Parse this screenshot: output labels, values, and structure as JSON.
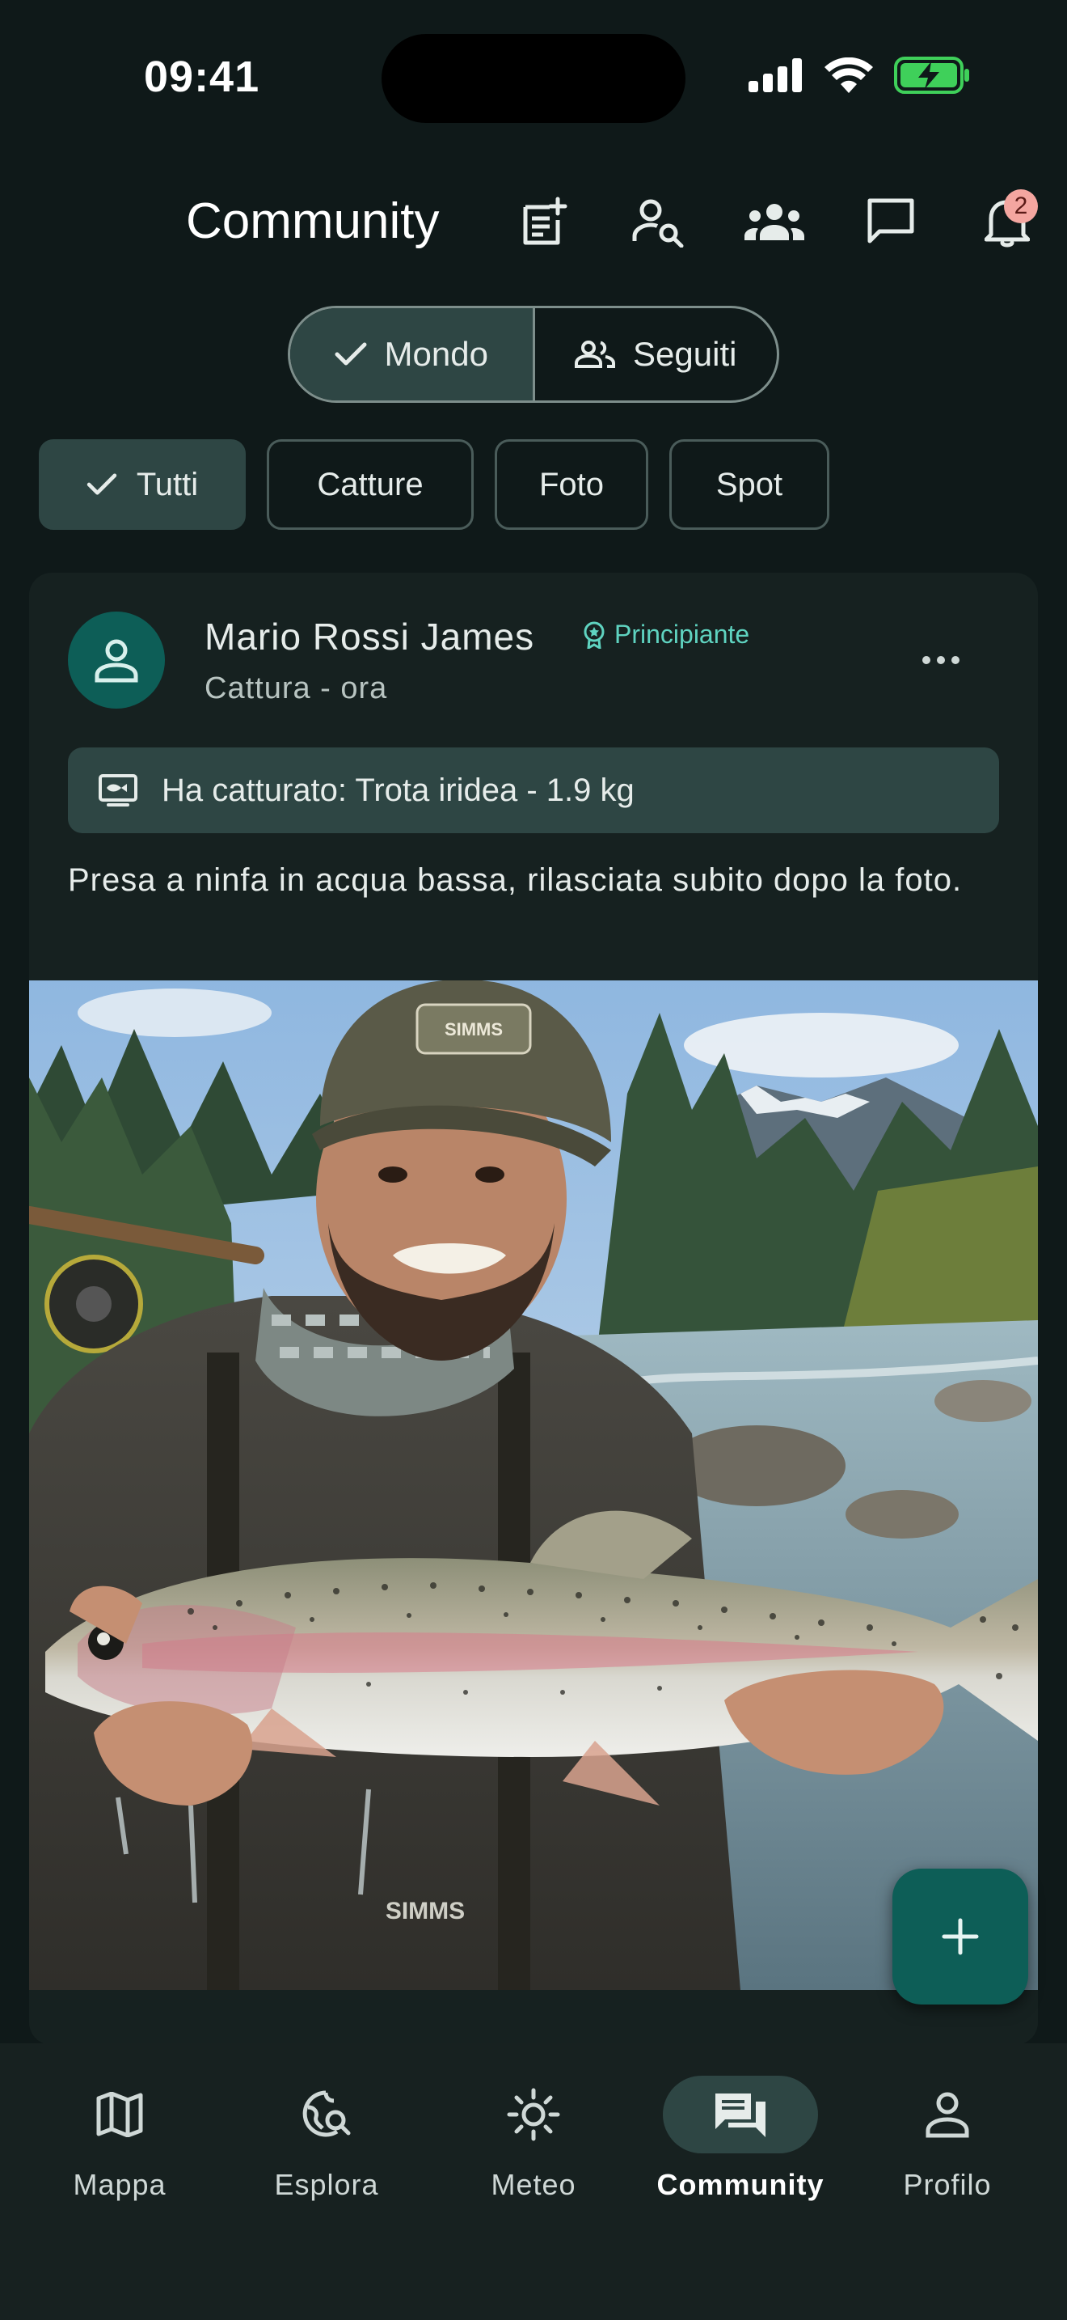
{
  "status_bar": {
    "time": "09:41"
  },
  "header": {
    "title": "Community",
    "notification_count": "2"
  },
  "feed_toggle": {
    "options": [
      {
        "label": "Mondo",
        "selected": true
      },
      {
        "label": "Seguiti",
        "selected": false
      }
    ]
  },
  "filters": {
    "chips": [
      {
        "label": "Tutti",
        "selected": true
      },
      {
        "label": "Catture",
        "selected": false
      },
      {
        "label": "Foto",
        "selected": false
      },
      {
        "label": "Spot",
        "selected": false
      }
    ]
  },
  "post": {
    "author": "Mario Rossi James",
    "level": "Principiante",
    "meta": "Cattura - ora",
    "catch_summary": "Ha catturato: Trota iridea - 1.9 kg",
    "text": "Presa a ninfa in acqua bassa, rilasciata subito dopo la foto.",
    "photo_brand": "SIMMS",
    "photo_brand_vest": "SIMMS"
  },
  "bottom_nav": {
    "items": [
      {
        "label": "Mappa",
        "icon": "map-icon",
        "active": false
      },
      {
        "label": "Esplora",
        "icon": "explore-icon",
        "active": false
      },
      {
        "label": "Meteo",
        "icon": "weather-icon",
        "active": false
      },
      {
        "label": "Community",
        "icon": "community-icon",
        "active": true
      },
      {
        "label": "Profilo",
        "icon": "profile-icon",
        "active": false
      }
    ]
  },
  "colors": {
    "background": "#0f1919",
    "card": "#162120",
    "accent": "#0d5e57",
    "chip_active": "#2e4644",
    "badge_text": "#5fd3c0",
    "notification_badge": "#f4a6a0"
  }
}
